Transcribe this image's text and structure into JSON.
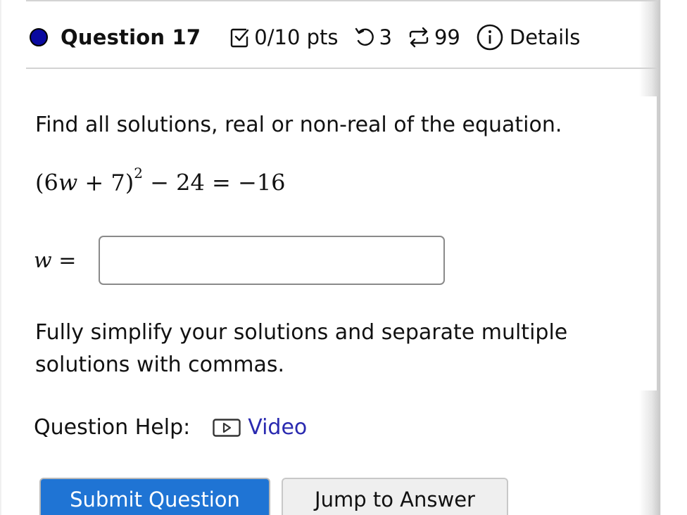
{
  "header": {
    "question_title": "Question 17",
    "score": "0/10 pts",
    "attempts_remaining": "3",
    "versions": "99",
    "details_label": "Details",
    "bullet_color": "#0a0aa0"
  },
  "question": {
    "prompt": "Find all solutions, real or non-real of the equation.",
    "equation": {
      "open": "(6",
      "var": "w",
      "mid": " + 7)",
      "exponent": "2",
      "rest": " − 24 = −16"
    },
    "answer_label": "w =",
    "answer_value": "",
    "answer_placeholder": "",
    "instructions": "Fully simplify your solutions and separate multiple solutions with commas."
  },
  "help": {
    "label": "Question Help:",
    "video_label": "Video",
    "link_color": "#2a2ab0"
  },
  "actions": {
    "submit_label": "Submit Question",
    "jump_label": "Jump to Answer",
    "submit_color": "#1f74d4"
  },
  "icons": {
    "score": "checkbox-check-icon",
    "attempts": "retry-icon",
    "versions": "repeat-icon",
    "details": "info-icon",
    "video": "video-play-icon"
  }
}
